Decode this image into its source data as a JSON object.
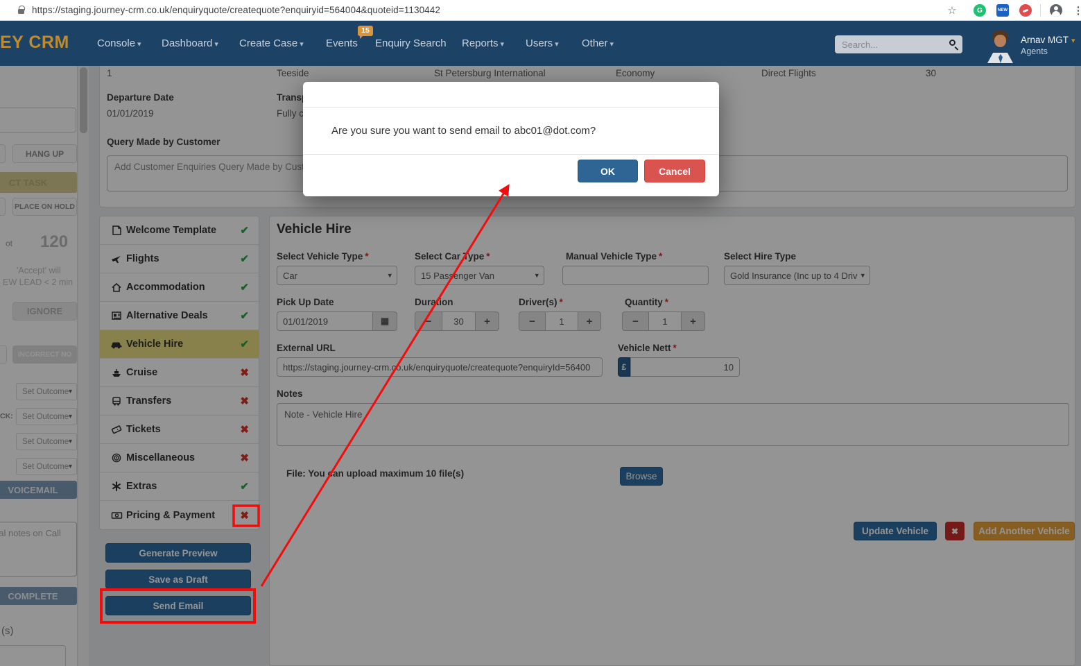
{
  "chrome": {
    "url": "https://staging.journey-crm.co.uk/enquiryquote/createquote?enquiryid=564004&quoteid=1130442",
    "new_badge": "NEW",
    "grammarly_letter": "G"
  },
  "navbar": {
    "logo": "EY CRM",
    "items": [
      {
        "label": "Console",
        "caret": "▾"
      },
      {
        "label": "Dashboard",
        "caret": "▾"
      },
      {
        "label": "Create Case",
        "caret": "▾"
      },
      {
        "label": "Events",
        "badge": "15"
      },
      {
        "label": "Enquiry Search"
      },
      {
        "label": "Reports",
        "caret": "▾"
      },
      {
        "label": "Users",
        "caret": "▾"
      },
      {
        "label": "Other",
        "caret": "▾"
      }
    ],
    "search_placeholder": "Search...",
    "user_name": "Arnav MGT",
    "user_caret": "▾",
    "user_role": "Agents"
  },
  "left_panel": {
    "hang_up": "HANG UP",
    "task_fragment": "CT TASK",
    "place_on_hold": "PLACE ON HOLD",
    "label_fragment": "ot",
    "timer": "120",
    "hint_line1": "'Accept' will",
    "hint_line2": "EW LEAD < 2 min",
    "ignore": "IGNORE",
    "incorrect_no": "INCORRECT NO",
    "callback_fragment": "CK:",
    "set_outcome": "Set Outcome",
    "voicemail": "VOICEMAIL",
    "call_notes_fragment": "nal notes on Call",
    "complete": "COMPLETE",
    "seconds_fragment": "(s)"
  },
  "summary": {
    "cells": [
      "1",
      "Teeside",
      "St Petersburg International",
      "Economy",
      "Direct Flights",
      "30"
    ],
    "departure_date_label": "Departure Date",
    "departure_date_value": "01/01/2019",
    "transport_label_fragment": "Transpo",
    "transport_value_fragment": "Fully cor",
    "query_label": "Query Made by Customer",
    "query_placeholder": "Add Customer Enquiries Query Made by Custom"
  },
  "templates": {
    "items": [
      {
        "label": "Welcome Template",
        "status": "✔"
      },
      {
        "label": "Flights",
        "status": "✔"
      },
      {
        "label": "Accommodation",
        "status": "✔"
      },
      {
        "label": "Alternative Deals",
        "status": "✔"
      },
      {
        "label": "Vehicle Hire",
        "status": "✔"
      },
      {
        "label": "Cruise",
        "status": "✖"
      },
      {
        "label": "Transfers",
        "status": "✖"
      },
      {
        "label": "Tickets",
        "status": "✖"
      },
      {
        "label": "Miscellaneous",
        "status": "✖"
      },
      {
        "label": "Extras",
        "status": "✔"
      },
      {
        "label": "Pricing & Payment",
        "status": "✖"
      }
    ],
    "generate_preview": "Generate Preview",
    "save_as_draft": "Save as Draft",
    "send_email": "Send Email"
  },
  "form": {
    "title": "Vehicle Hire",
    "required_mark": "*",
    "select_vehicle_type_label": "Select Vehicle Type",
    "select_vehicle_type_value": "Car",
    "select_car_type_label": "Select Car Type",
    "select_car_type_value": "15 Passenger Van",
    "manual_vehicle_type_label": "Manual Vehicle Type",
    "select_hire_type_label": "Select Hire Type",
    "select_hire_type_value": "Gold Insurance (Inc up to 4 Driv",
    "pick_up_date_label": "Pick Up Date",
    "pick_up_date_value": "01/01/2019",
    "duration_label": "Duration",
    "duration_value": "30",
    "drivers_label": "Driver(s)",
    "drivers_value": "1",
    "quantity_label": "Quantity",
    "quantity_value": "1",
    "external_url_label": "External URL",
    "external_url_value": "https://staging.journey-crm.co.uk/enquiryquote/createquote?enquiryId=56400",
    "vehicle_nett_label": "Vehicle Nett",
    "currency": "£",
    "vehicle_nett_value": "10",
    "notes_label": "Notes",
    "notes_value": "Note - Vehicle Hire",
    "file_hint": "File: You can upload maximum 10 file(s)",
    "browse": "Browse",
    "update_vehicle": "Update Vehicle",
    "remove_glyph": "✖",
    "add_another_vehicle": "Add Another Vehicle"
  },
  "modal": {
    "message": "Are you sure you want to send email to abc01@dot.com?",
    "ok": "OK",
    "cancel": "Cancel"
  },
  "icons": {
    "caret_down": "▾",
    "check": "✔",
    "cross": "✖",
    "minus": "−",
    "plus": "+",
    "calendar": "▦",
    "star": "☆",
    "dots": "⋮"
  },
  "colors": {
    "navbar": "#1c4266",
    "accent_gold": "#c08a2e",
    "primary_button": "#2e6da4",
    "danger": "#d9534f",
    "warning": "#e8a33c",
    "highlight_row": "#eadf84",
    "annotation": "#ff0000"
  }
}
